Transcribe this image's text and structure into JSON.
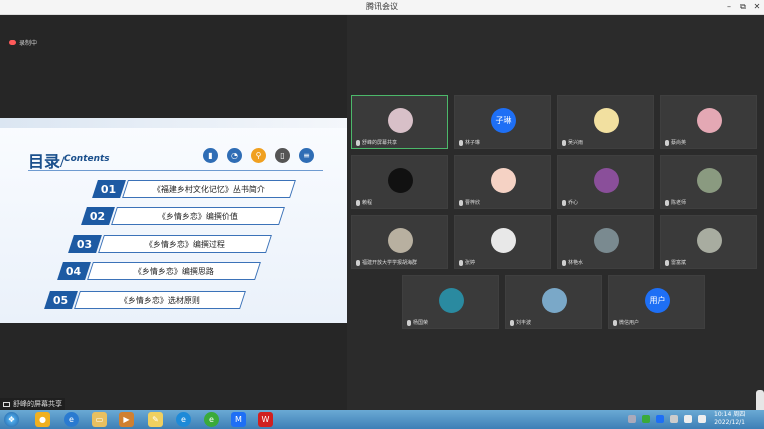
{
  "window": {
    "title": "腾讯会议",
    "min": "–",
    "max": "⧉",
    "close": "✕"
  },
  "status": {
    "recording": "录制中"
  },
  "slide": {
    "title": "目录/",
    "title_en": "Contents",
    "items": [
      {
        "num": "01",
        "label": "《福建乡村文化记忆》丛书简介"
      },
      {
        "num": "02",
        "label": "《乡情乡恋》编撰价值"
      },
      {
        "num": "03",
        "label": "《乡情乡恋》编撰过程"
      },
      {
        "num": "04",
        "label": "《乡情乡恋》编撰思路"
      },
      {
        "num": "05",
        "label": "《乡情乡恋》选材原则"
      }
    ]
  },
  "share_label": "舒峰的屏幕共享",
  "participants": [
    {
      "name": "舒峰的屏幕共享",
      "avatar": "photo",
      "color": "#d8c0c8"
    },
    {
      "name": "林子琳",
      "avatar": "text",
      "text": "子琳",
      "color": "#1e6ff5"
    },
    {
      "name": "吴兴雨",
      "avatar": "photo",
      "color": "#f2e0a0"
    },
    {
      "name": "蔡尚英",
      "avatar": "photo",
      "color": "#e4a8b4"
    },
    {
      "name": "赖程",
      "avatar": "photo",
      "color": "#111111"
    },
    {
      "name": "曹梓欣",
      "avatar": "photo",
      "color": "#f5d2c4"
    },
    {
      "name": "乔心",
      "avatar": "photo",
      "color": "#8a4f9a"
    },
    {
      "name": "陈老师",
      "avatar": "photo",
      "color": "#8a9a80"
    },
    {
      "name": "福建开放大学学报胡海群",
      "avatar": "photo",
      "color": "#b8b0a0"
    },
    {
      "name": "张婷",
      "avatar": "photo",
      "color": "#e8e8e8"
    },
    {
      "name": "林艳水",
      "avatar": "photo",
      "color": "#7a8a90"
    },
    {
      "name": "雷富斌",
      "avatar": "photo",
      "color": "#a8aca0"
    },
    {
      "name": "杨国荣",
      "avatar": "photo",
      "color": "#2a8aa0"
    },
    {
      "name": "刘丰波",
      "avatar": "photo",
      "color": "#7aa8c8"
    },
    {
      "name": "微信用户",
      "avatar": "text",
      "text": "用户",
      "color": "#1e6ff5"
    }
  ],
  "clock": {
    "time": "10:14 周四",
    "date": "2022/12/1"
  }
}
